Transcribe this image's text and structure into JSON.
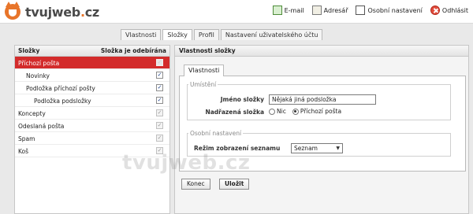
{
  "brand": {
    "name": "tvujweb",
    "suffix": "cz",
    "accent": "#e8752a"
  },
  "topnav": [
    {
      "label": "E-mail",
      "icon": "mail-icon"
    },
    {
      "label": "Adresář",
      "icon": "address-book-icon"
    },
    {
      "label": "Osobní nastavení",
      "icon": "personal-settings-icon"
    },
    {
      "label": "Odhlásit",
      "icon": "logout-icon"
    }
  ],
  "tabs": [
    {
      "label": "Vlastnosti"
    },
    {
      "label": "Složky",
      "active": true
    },
    {
      "label": "Profil"
    },
    {
      "label": "Nastavení uživatelského účtu"
    }
  ],
  "folders": {
    "header_name": "Složky",
    "header_subscribed": "Složka je odebírána",
    "selected_color": "#d32b2b",
    "rows": [
      {
        "name": "Příchozí pošta",
        "level": 0,
        "subscribed": true,
        "disabled": true,
        "selected": true
      },
      {
        "name": "Novinky",
        "level": 1,
        "subscribed": true,
        "disabled": false
      },
      {
        "name": "Podložka příchozí pošty",
        "level": 1,
        "subscribed": true,
        "disabled": false
      },
      {
        "name": "Podložka podsložky",
        "level": 2,
        "subscribed": true,
        "disabled": false
      },
      {
        "name": "Koncepty",
        "level": 0,
        "subscribed": true,
        "disabled": true
      },
      {
        "name": "Odeslaná pošta",
        "level": 0,
        "subscribed": true,
        "disabled": true
      },
      {
        "name": "Spam",
        "level": 0,
        "subscribed": true,
        "disabled": true
      },
      {
        "name": "Koš",
        "level": 0,
        "subscribed": true,
        "disabled": true
      }
    ]
  },
  "properties": {
    "title": "Vlastnosti složky",
    "inner_tab": "Vlastnosti",
    "location": {
      "legend": "Umístění",
      "name_label": "Jméno složky",
      "name_value": "Nějaká jiná podsložka",
      "parent_label": "Nadřazená složka",
      "parent_options": [
        {
          "label": "Nic",
          "checked": false
        },
        {
          "label": "Příchozí pošta",
          "checked": true
        }
      ]
    },
    "personal": {
      "legend": "Osobní nastavení",
      "mode_label": "Režim zobrazení seznamu",
      "mode_value": "Seznam"
    },
    "buttons": {
      "cancel": "Konec",
      "save": "Uložit"
    }
  },
  "watermark": "tvujweb.cz"
}
